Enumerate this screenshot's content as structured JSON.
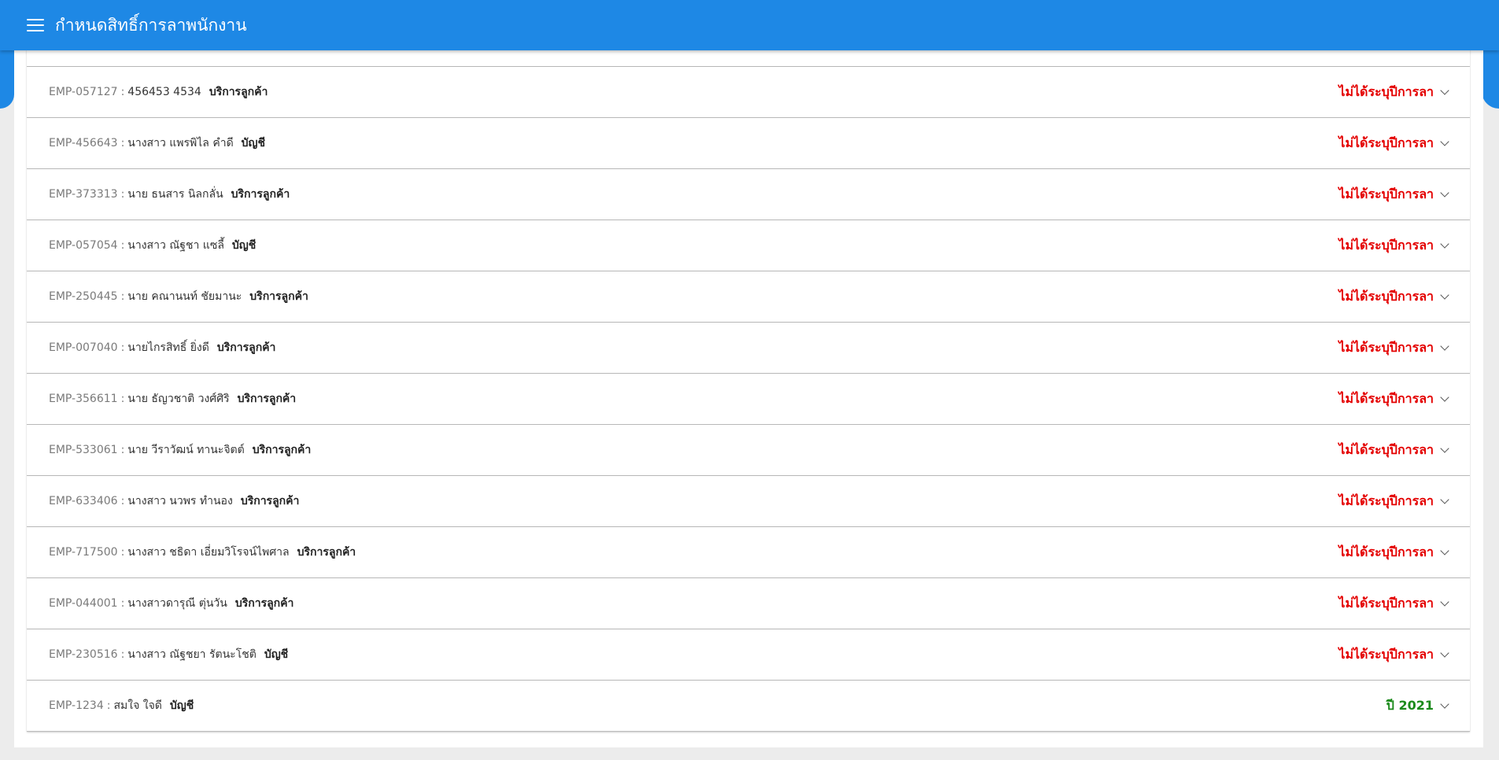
{
  "header": {
    "title": "กำหนดสิทธิ์การลาพนักงาน",
    "menu_icon": "hamburger-menu-icon"
  },
  "colors": {
    "header": "#1e88e5",
    "not_set": "#e40000",
    "set": "#1b8a1b"
  },
  "separator": ":",
  "employees": [
    {
      "id": "EMP-057127",
      "name": "456453 4534",
      "department": "บริการลูกค้า",
      "status": "ไม่ได้ระบุปีการลา",
      "status_type": "red"
    },
    {
      "id": "EMP-456643",
      "name": "นางสาว แพรพิไล คำดี",
      "department": "บัญชี",
      "status": "ไม่ได้ระบุปีการลา",
      "status_type": "red"
    },
    {
      "id": "EMP-373313",
      "name": "นาย ธนสาร นิลกลั่น",
      "department": "บริการลูกค้า",
      "status": "ไม่ได้ระบุปีการลา",
      "status_type": "red"
    },
    {
      "id": "EMP-057054",
      "name": "นางสาว ณัฐชา แซลี้",
      "department": "บัญชี",
      "status": "ไม่ได้ระบุปีการลา",
      "status_type": "red"
    },
    {
      "id": "EMP-250445",
      "name": "นาย คณานนท์ ชัยมานะ",
      "department": "บริการลูกค้า",
      "status": "ไม่ได้ระบุปีการลา",
      "status_type": "red"
    },
    {
      "id": "EMP-007040",
      "name": "นายไกรสิทธิ์ ยิ่งดี",
      "department": "บริการลูกค้า",
      "status": "ไม่ได้ระบุปีการลา",
      "status_type": "red"
    },
    {
      "id": "EMP-356611",
      "name": "นาย ธัญวชาติ วงศ์ศิริ",
      "department": "บริการลูกค้า",
      "status": "ไม่ได้ระบุปีการลา",
      "status_type": "red"
    },
    {
      "id": "EMP-533061",
      "name": "นาย วีราวัฒน์ ทานะจิตต์",
      "department": "บริการลูกค้า",
      "status": "ไม่ได้ระบุปีการลา",
      "status_type": "red"
    },
    {
      "id": "EMP-633406",
      "name": "นางสาว นวพร ทำนอง",
      "department": "บริการลูกค้า",
      "status": "ไม่ได้ระบุปีการลา",
      "status_type": "red"
    },
    {
      "id": "EMP-717500",
      "name": "นางสาว ชธิดา เอี่ยมวิโรจน์ไพศาล",
      "department": "บริการลูกค้า",
      "status": "ไม่ได้ระบุปีการลา",
      "status_type": "red"
    },
    {
      "id": "EMP-044001",
      "name": "นางสาวดารุณี ตุ่นวัน",
      "department": "บริการลูกค้า",
      "status": "ไม่ได้ระบุปีการลา",
      "status_type": "red"
    },
    {
      "id": "EMP-230516",
      "name": "นางสาว ณัฐชยา รัตนะโชติ",
      "department": "บัญชี",
      "status": "ไม่ได้ระบุปีการลา",
      "status_type": "red"
    },
    {
      "id": "EMP-1234",
      "name": "สมใจ ใจดี",
      "department": "บัญชี",
      "status": "ปี 2021",
      "status_type": "green"
    }
  ]
}
